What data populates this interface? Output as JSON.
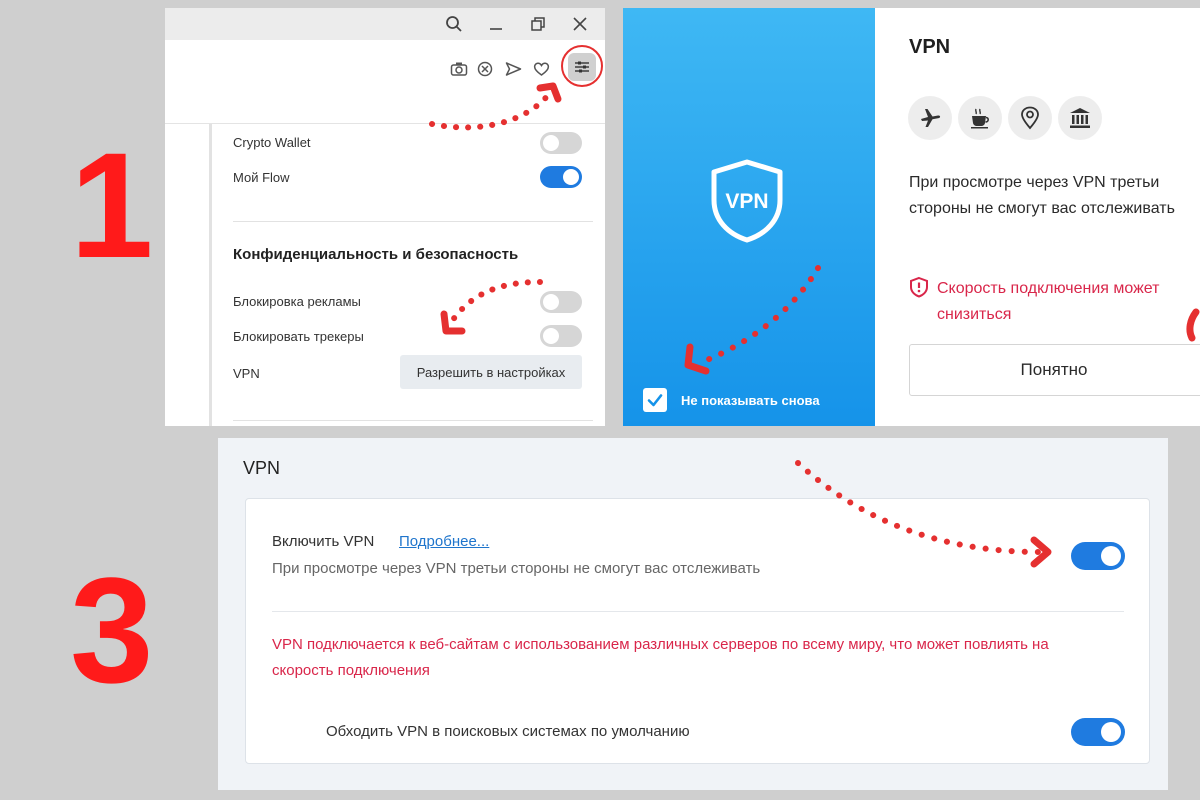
{
  "steps": {
    "first": "1",
    "third": "3"
  },
  "browser_panel": {
    "titlebar_icons": [
      "search-icon",
      "minimize-icon",
      "restore-icon",
      "close-icon"
    ],
    "toolbar_icons": [
      "camera-icon",
      "block-icon",
      "send-icon",
      "heart-icon",
      "settings-icon"
    ],
    "rows": {
      "crypto_wallet": "Crypto Wallet",
      "my_flow": "Мой Flow",
      "section_title": "Конфиденциальность и безопасность",
      "ad_block": "Блокировка рекламы",
      "tracker_block": "Блокировать трекеры",
      "vpn": "VPN",
      "vpn_button": "Разрешить в настройках"
    },
    "toggles": {
      "crypto_wallet": false,
      "my_flow": true,
      "ad_block": false,
      "tracker_block": false
    }
  },
  "vpn_popup": {
    "shield_label": "VPN",
    "dont_show_again": "Не показывать снова",
    "dont_show_checked": true,
    "title": "VPN",
    "feature_icons": [
      "airplane-icon",
      "coffee-icon",
      "location-pin-icon",
      "bank-icon"
    ],
    "description": "При просмотре через VPN третьи стороны не смогут вас отслеживать",
    "warning": "Скорость подключения может снизиться",
    "ok_button": "Понятно"
  },
  "vpn_settings": {
    "title": "VPN",
    "enable_label": "Включить VPN",
    "more_link": "Подробнее...",
    "enable_description": "При просмотре через VPN третьи стороны не смогут вас отслеживать",
    "enabled": true,
    "warning": "VPN подключается к веб-сайтам с использованием различных серверов по всему миру, что может повлиять на скорость подключения",
    "bypass_label": "Обходить VPN в поисковых системах по умолчанию",
    "bypass_enabled": true
  },
  "colors": {
    "accent": "#1f7be0",
    "warning": "#d9264a",
    "annotation": "#e53030",
    "popup_blue": "#1593e9"
  }
}
